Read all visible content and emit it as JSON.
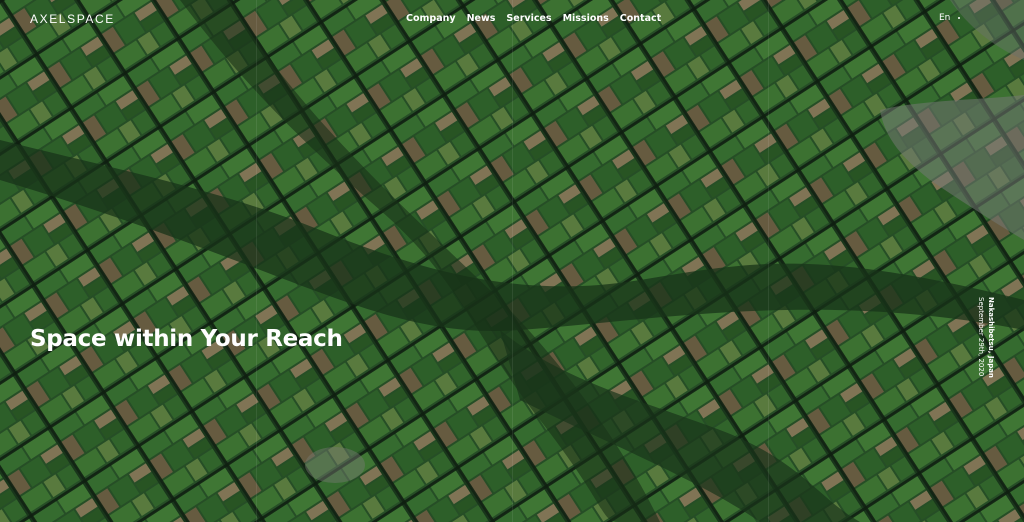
{
  "header": {
    "logo": "AXELSPACE",
    "nav": [
      "Company",
      "News",
      "Services",
      "Missions",
      "Contact"
    ],
    "language": "En"
  },
  "hero": {
    "headline": "Space within Your Reach",
    "caption_location": "Nakashibetsu, Japan",
    "caption_date": "September 29th, 2020",
    "image": "satellite-farmland-image"
  },
  "colors": {
    "text": "#ffffff",
    "field_dark": "#1e3b22",
    "field_green": "#3f7a35",
    "field_brown": "#8a7a5c"
  }
}
